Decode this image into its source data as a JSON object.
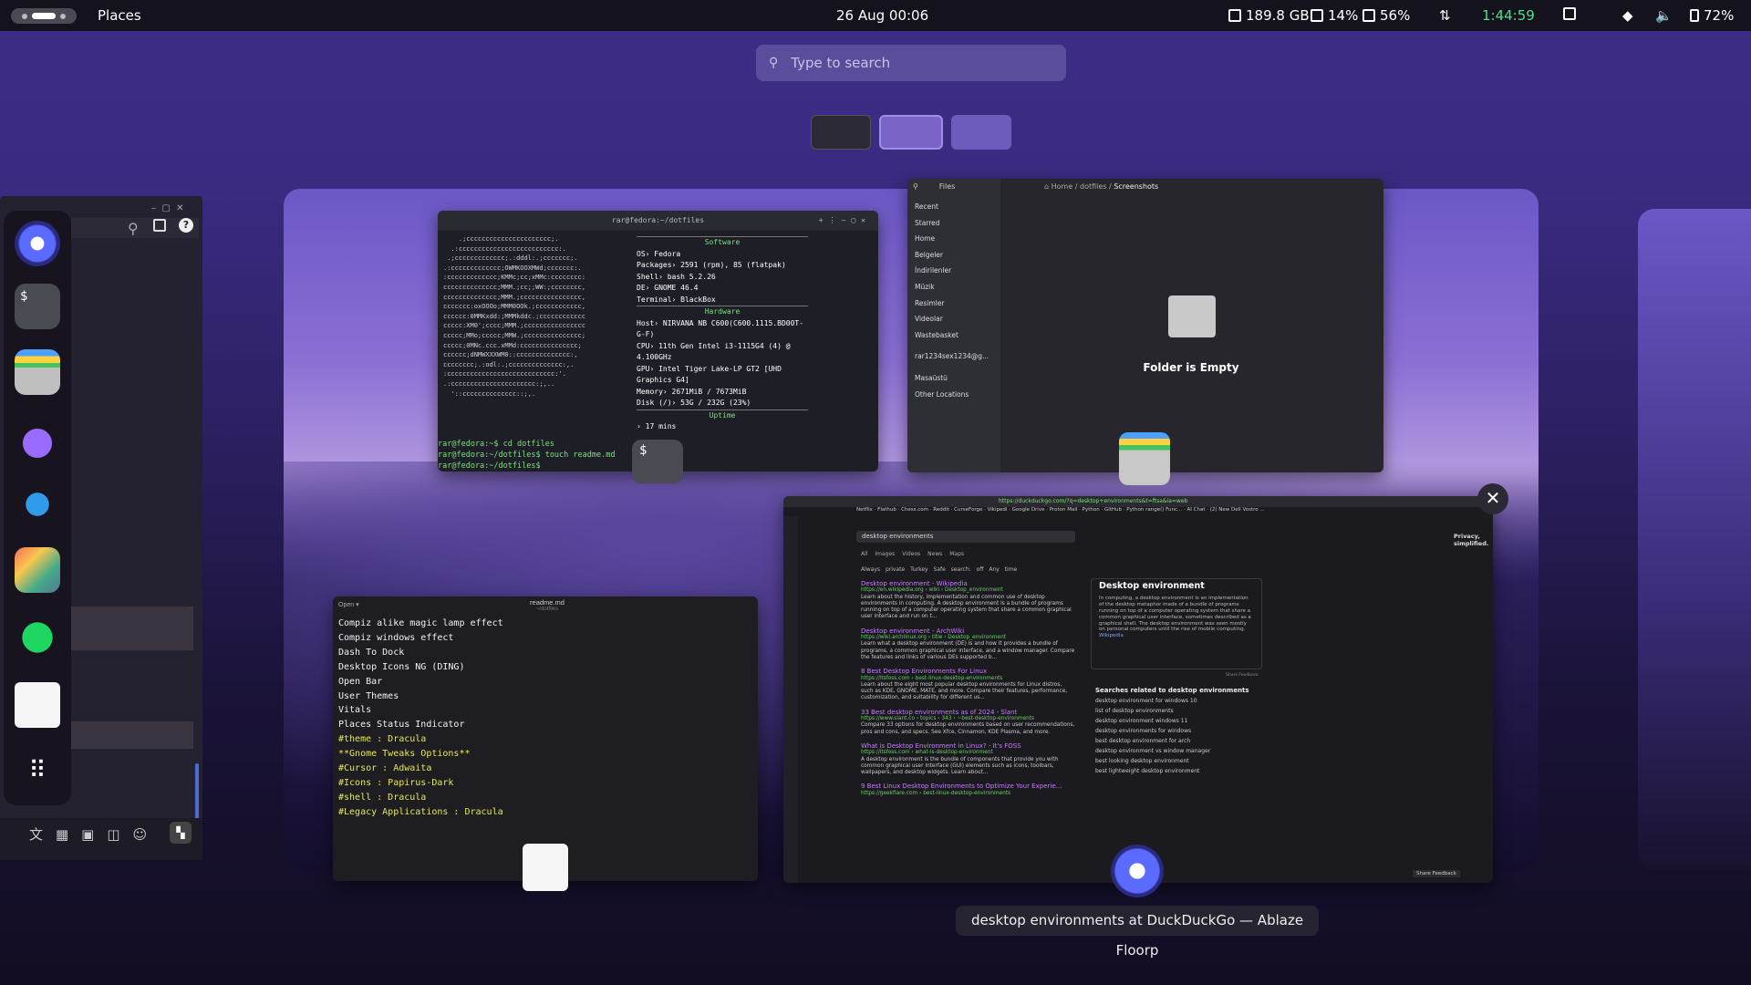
{
  "topbar": {
    "places": "Places",
    "clock": "26 Aug  00:06",
    "disk": "189.8 GB",
    "mem": "14%",
    "cpu": "56%",
    "uptime": "1:44:59",
    "battery": "72%"
  },
  "search": {
    "placeholder": "Type to search"
  },
  "terminal": {
    "title": "rar@fedora:~/dotfiles",
    "software_header": "Software",
    "hardware_header": "Hardware",
    "uptime_header": "Uptime",
    "info": [
      "OS› Fedora",
      "Packages› 2591 (rpm), 85 (flatpak)",
      "Shell› bash 5.2.26",
      "DE› GNOME 46.4",
      "Terminal› BlackBox"
    ],
    "hw": [
      "Host› NIRVANA NB C600(C600.1115.BD00T-G-F)",
      "CPU› 11th Gen Intel i3-1115G4 (4) @ 4.100GHz",
      "GPU› Intel Tiger Lake-LP GT2 [UHD Graphics G4]",
      "Memory› 2671MiB / 7673MiB",
      "Disk (/)› 53G / 232G (23%)"
    ],
    "uptime": "› 17 mins",
    "cmds": [
      "rar@fedora:~$ cd dotfiles",
      "rar@fedora:~/dotfiles$ touch readme.md",
      "rar@fedora:~/dotfiles$ "
    ]
  },
  "files": {
    "app": "Files",
    "path_home": "Home",
    "path_dotfiles": "dotfiles",
    "path_current": "Screenshots",
    "sidebar": [
      "Recent",
      "Starred",
      "Home",
      "Belgeler",
      "İndirilenler",
      "Müzik",
      "Resimler",
      "Videolar",
      "Wastebasket",
      "rar1234sex1234@g...",
      "Masaüstü",
      "Other Locations"
    ],
    "empty": "Folder is Empty"
  },
  "editor": {
    "open": "Open",
    "title": "readme.md",
    "subtitle": "~/dotfiles",
    "lines": [
      "Compiz alike magic lamp effect",
      "Compiz windows effect",
      "Dash To Dock",
      "Desktop Icons NG (DING)",
      "Open Bar",
      "User Themes",
      "Vitals",
      "Places Status Indicator"
    ],
    "yellow": [
      "#theme : Dracula",
      "**Gnome Tweaks Options**",
      "#Cursor : Adwaita",
      "#Icons : Papirus-Dark",
      "#shell : Dracula",
      "#Legacy Applications : Dracula"
    ]
  },
  "browser": {
    "url": "https://duckduckgo.com/?q=desktop+environments&t=ftsa&ia=web",
    "bookmarks": [
      "Netflix",
      "Flathub",
      "Chess.com",
      "Reddit",
      "CurseForge",
      "Vikipedi",
      "Google Drive",
      "Proton Mail",
      "Python",
      "GitHub",
      "Python range() Func...",
      "AI Chat",
      "(2) New Dell Vostro ..."
    ],
    "query": "desktop environments",
    "tabs": [
      "All",
      "Images",
      "Videos",
      "News",
      "Maps"
    ],
    "filters": [
      "Always private",
      "Turkey",
      "Safe search: off",
      "Any time"
    ],
    "privacy": "Privacy, simplified.",
    "results": [
      {
        "title": "Desktop environment - Wikipedia",
        "url": "https://en.wikipedia.org › wiki › Desktop_environment",
        "snip": "Learn about the history, implementation and common use of desktop environments in computing. A desktop environment is a bundle of programs running on top of a computer operating system that share a common graphical user interface and run on t..."
      },
      {
        "title": "Desktop environment - ArchWiki",
        "url": "https://wiki.archlinux.org › title › Desktop_environment",
        "snip": "Learn what a desktop environment (DE) is and how it provides a bundle of programs, a common graphical user interface, and a window manager. Compare the features and links of various DEs supported b..."
      },
      {
        "title": "8 Best Desktop Environments For Linux",
        "url": "https://itsfoss.com › best-linux-desktop-environments",
        "snip": "Learn about the eight most popular desktop environments for Linux distros, such as KDE, GNOME, MATE, and more. Compare their features, performance, customization, and suitability for different us..."
      },
      {
        "title": "33 Best desktop environments as of 2024 - Slant",
        "url": "https://www.slant.co › topics › 343 › ~best-desktop-environments",
        "snip": "Compare 33 options for desktop environments based on user recommendations, pros and cons, and specs. See Xfce, Cinnamon, KDE Plasma, and more."
      },
      {
        "title": "What is Desktop Environment in Linux? - It's FOSS",
        "url": "https://itsfoss.com › what-is-desktop-environment",
        "snip": "A desktop environment is the bundle of components that provide you with common graphical user interface (GUI) elements such as icons, toolbars, wallpapers, and desktop widgets. Learn about..."
      },
      {
        "title": "9 Best Linux Desktop Environments to Optimize Your Experie...",
        "url": "https://geekflare.com › best-linux-desktop-environments",
        "snip": ""
      }
    ],
    "panel_title": "Desktop environment",
    "panel_text": "In computing, a desktop environment is an implementation of the desktop metaphor made of a bundle of programs running on top of a computer operating system that share a common graphical user interface, sometimes described as a graphical shell. The desktop environment was seen mostly on personal computers until the rise of mobile computing.",
    "panel_link": "Wikipedia",
    "share": "Share Feedback",
    "related_title": "Searches related to desktop environments",
    "related": [
      "desktop environment for windows 10",
      "list of desktop environments",
      "desktop environment windows 11",
      "desktop environments for windows",
      "best desktop environment for arch",
      "desktop environment vs window manager",
      "best looking desktop environment",
      "best lightweight desktop environment"
    ],
    "share_bottom": "Share Feedback"
  },
  "caption": "desktop environments at DuckDuckGo — Ablaze Floorp",
  "close": "✕"
}
